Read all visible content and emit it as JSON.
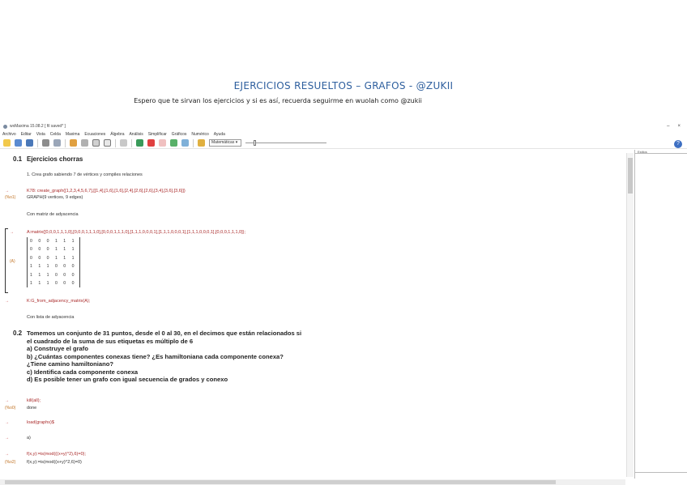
{
  "document": {
    "title": "EJERCICIOS RESUELTOS – GRAFOS - @ZUKII",
    "subtitle": "Espero que te sirvan los ejercicios y si es así, recuerda seguirme en wuolah como @zukii"
  },
  "window": {
    "title": "wxMaxima 15.08.2 [ fil saved* ]",
    "controls": [
      "–",
      "×"
    ]
  },
  "menu": [
    "Archivo",
    "Editar",
    "Vista",
    "Celda",
    "Maxima",
    "Ecuaciones",
    "Álgebra",
    "Análisis",
    "Simplificar",
    "Gráficos",
    "Numérico",
    "Ayuda"
  ],
  "toolbar": {
    "cell_type": "Matemáticas",
    "help": "?"
  },
  "side_panel": {
    "header": "Estilos"
  },
  "worksheet": {
    "s1_num": "0.1",
    "s1_title": "Ejercicios chorras",
    "t1": "1. Crea grafo sabiendo 7 de vértices y compiles relaciones",
    "in1_lbl": "→",
    "in1": "K78: create_graph([1,2,3,4,5,6,7],[[1,4],[1,6],[1,6],[2,4],[2,6],[2,6],[3,4],[3,6],[3,6]])",
    "out1_lbl": "(%o1)",
    "out1": "GRAPH(9 vertices, 9 edges)",
    "t2": "Con matriz de adyacencia",
    "in2_lbl": "→",
    "in2": "A:matrix([0,0,0,1,1,1,0],[0,0,0,1,1,1,0],[0,0,0,1,1,1,0],[1,1,1,0,0,0,1],[1,1,1,0,0,0,1],[1,1,1,0,0,0,1],[0,0,0,1,1,1,0]);",
    "out2_lbl": "(A)",
    "matrix_rows": [
      "0 0 0 1 1 1",
      "0 0 0 1 1 1",
      "0 0 0 1 1 1",
      "1 1 1 0 0 0",
      "1 1 1 0 0 0",
      "1 1 1 0 0 0"
    ],
    "in3_lbl": "→",
    "in3": "K:G_from_adjacency_matrix(A);",
    "t3": "Con lista de adyacencia",
    "s2_num": "0.2",
    "p1": "Tomemos un conjunto de 31 puntos, desde el 0 al 30, en el decimos que están relacionados si",
    "p2": "el cuadrado de la suma de sus etiquetas es múltiplo de 6",
    "p3": "a) Construye el grafo",
    "p4": "b) ¿Cuántas componentes conexas tiene? ¿Es hamiltoniana cada componente conexa?",
    "p5": "¿Tiene camino hamiltoniano?",
    "p6": "c) Identifica cada componente conexa",
    "p7": "d) Es posible tener un grafo con igual secuencia de grados y conexo",
    "in4_lbl": "→",
    "in4": "kill(all);",
    "out4_lbl": "(%o0)",
    "out4": "done",
    "in5_lbl": "→",
    "in5": "load(graphs)$",
    "in6_lbl": "→",
    "in6": "a)",
    "in7_lbl": "→",
    "in7": "f(x,y):=is(mod(((x+y)^2),6)=0);",
    "out7_lbl": "(%o2)",
    "out7": "f(x,y):=is(mod((x+y)^2,6)=0)"
  }
}
